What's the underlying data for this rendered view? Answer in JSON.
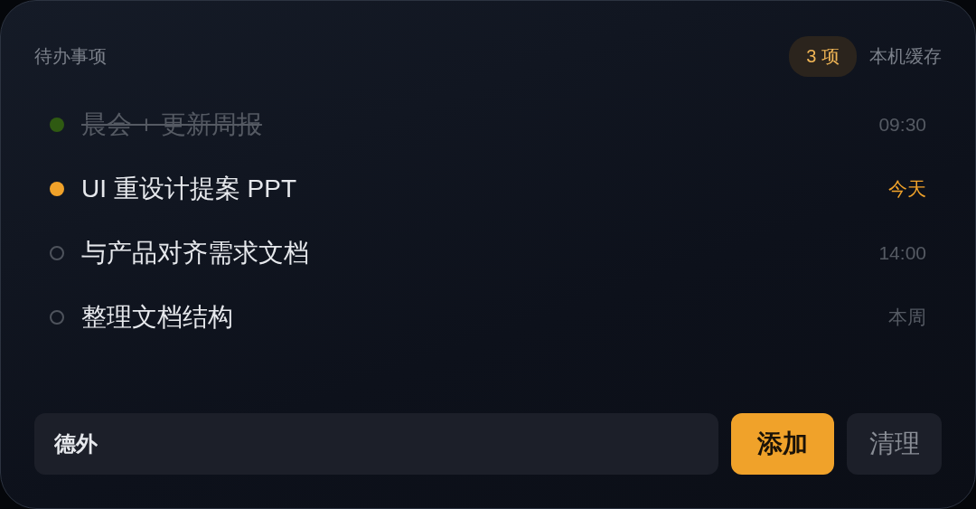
{
  "header": {
    "title": "待办事项",
    "count_badge": "3 项",
    "storage_label": "本机缓存"
  },
  "todos": [
    {
      "text": "晨会 + 更新周报",
      "due": "09:30",
      "kind": "done",
      "color": "#2f5a12"
    },
    {
      "text": "UI 重设计提案 PPT",
      "due": "今天",
      "kind": "today",
      "color": "#f0a22a"
    },
    {
      "text": "与产品对齐需求文档",
      "due": "14:00",
      "kind": "open"
    },
    {
      "text": "整理文档结构",
      "due": "本周",
      "kind": "open"
    }
  ],
  "composer": {
    "value": "德外",
    "add_button": "添加",
    "clear_button": "清理"
  }
}
